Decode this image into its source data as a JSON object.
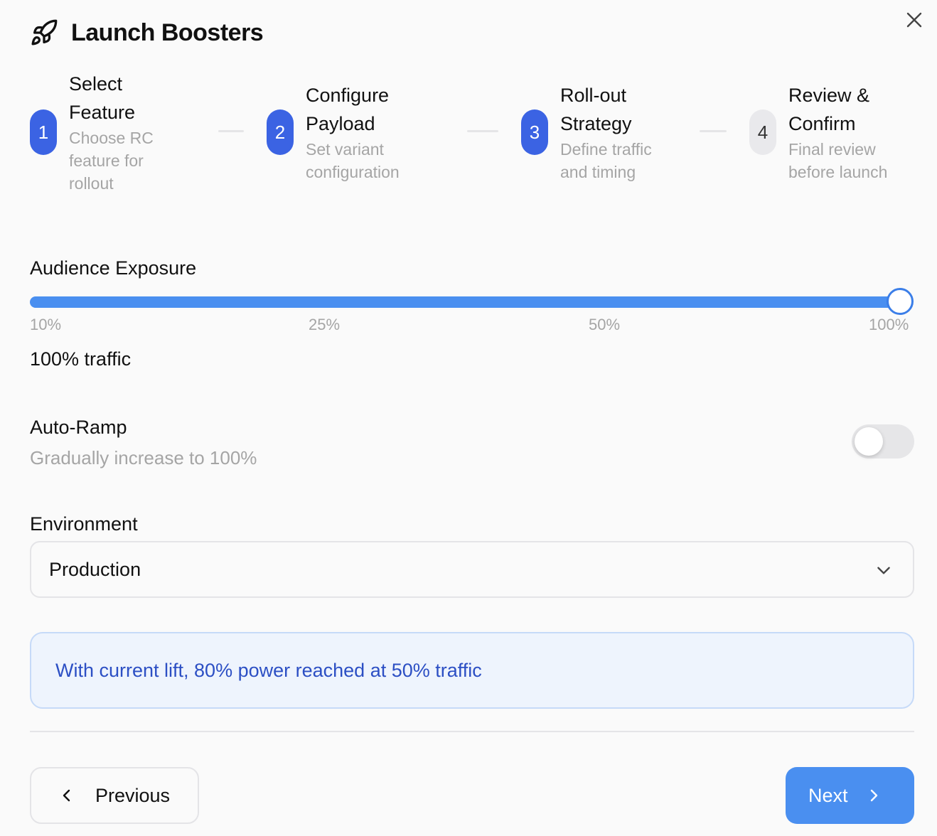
{
  "dialog": {
    "title": "Launch Boosters",
    "icon": "rocket-icon",
    "close_icon": "close-icon"
  },
  "steps": [
    {
      "number": "1",
      "title_line1": "Select",
      "title_line2": "Feature",
      "desc_line1": "Choose RC",
      "desc_line2": "feature for",
      "desc_line3": "rollout",
      "state": "complete"
    },
    {
      "number": "2",
      "title_line1": "Configure",
      "title_line2": "Payload",
      "desc_line1": "Set variant",
      "desc_line2": "configuration",
      "state": "complete"
    },
    {
      "number": "3",
      "title_line1": "Roll-out",
      "title_line2": "Strategy",
      "desc_line1": "Define traffic",
      "desc_line2": "and timing",
      "state": "current"
    },
    {
      "number": "4",
      "title_line1": "Review &",
      "title_line2": "Confirm",
      "desc_line1": "Final review",
      "desc_line2": "before launch",
      "state": "upcoming"
    }
  ],
  "exposure": {
    "label": "Audience Exposure",
    "value_percent": 100,
    "ticks": [
      "10%",
      "25%",
      "50%",
      "100%"
    ],
    "value_text": "100% traffic"
  },
  "auto_ramp": {
    "label": "Auto-Ramp",
    "description": "Gradually increase to 100%",
    "enabled": false
  },
  "environment": {
    "label": "Environment",
    "selected": "Production"
  },
  "info": {
    "message": "With current lift, 80% power reached at 50% traffic"
  },
  "footer": {
    "previous_label": "Previous",
    "next_label": "Next"
  },
  "colors": {
    "primary": "#3b63e3",
    "slider": "#4a8ff0",
    "next_button": "#4a8ff0",
    "info_bg": "#eef4fd",
    "info_text": "#2c4fc4"
  }
}
